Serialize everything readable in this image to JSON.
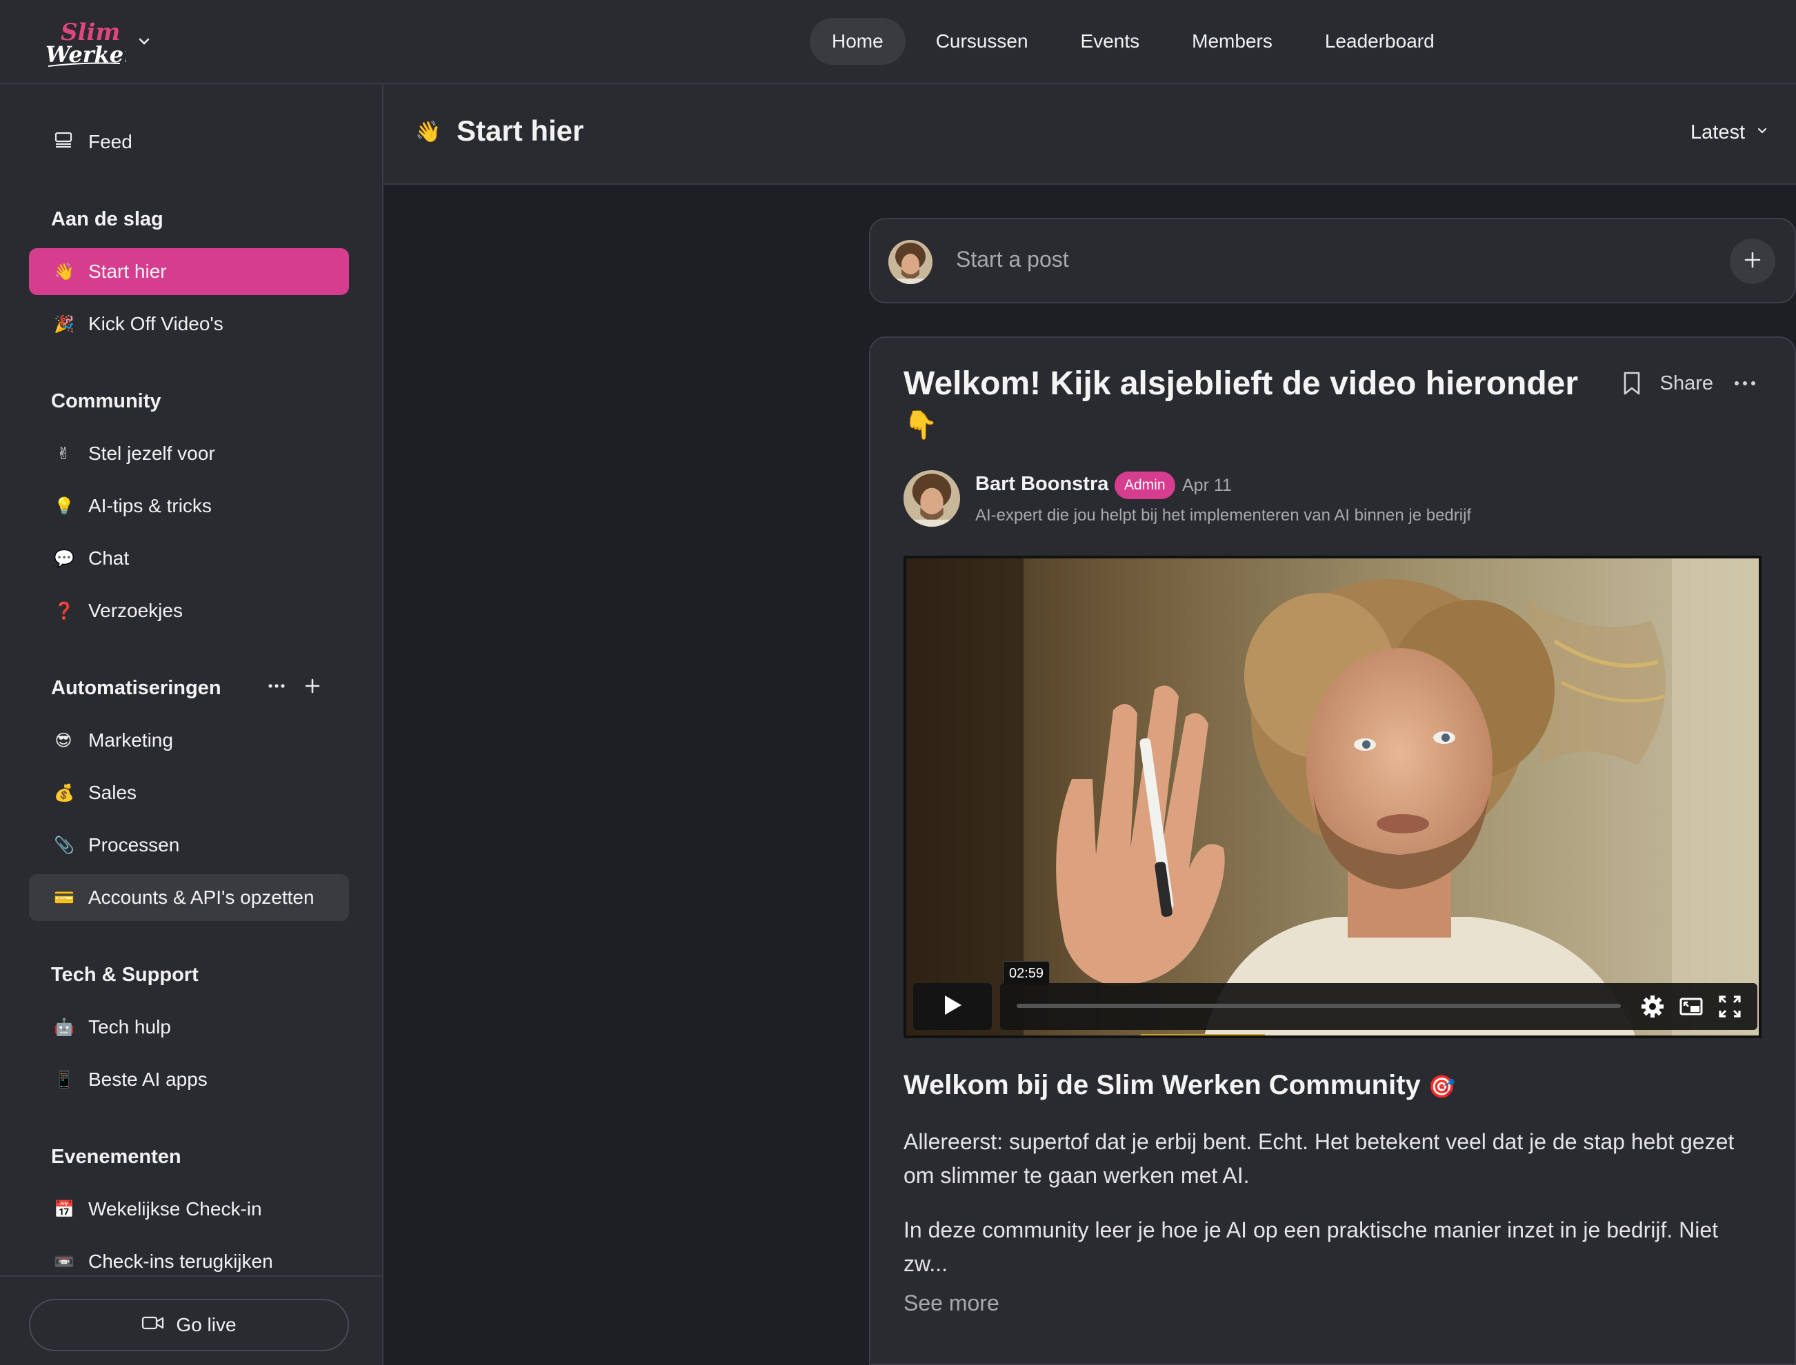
{
  "app": {
    "logo_text_top": "Slim",
    "logo_text_bottom": "Werken",
    "brand_color": "#d63d8f"
  },
  "topnav": {
    "items": [
      {
        "label": "Home",
        "active": true
      },
      {
        "label": "Cursussen"
      },
      {
        "label": "Events"
      },
      {
        "label": "Members"
      },
      {
        "label": "Leaderboard"
      }
    ]
  },
  "sidebar": {
    "feed": {
      "label": "Feed",
      "icon": "feed-icon"
    },
    "sections": [
      {
        "heading": "Aan de slag",
        "items": [
          {
            "emoji": "👋",
            "label": "Start hier",
            "active": true
          },
          {
            "emoji": "🎉",
            "label": "Kick Off Video's"
          }
        ]
      },
      {
        "heading": "Community",
        "items": [
          {
            "emoji": "✌",
            "label": "Stel jezelf voor"
          },
          {
            "emoji": "💡",
            "label": "AI-tips & tricks"
          },
          {
            "emoji": "💬",
            "label": "Chat"
          },
          {
            "emoji": "❓",
            "label": "Verzoekjes"
          }
        ]
      },
      {
        "heading": "Automatiseringen",
        "items": [
          {
            "emoji": "😎",
            "label": "Marketing"
          },
          {
            "emoji": "💰",
            "label": "Sales"
          },
          {
            "emoji": "📎",
            "label": "Processen"
          },
          {
            "emoji": "💳",
            "label": "Accounts & API's opzetten",
            "selected": true
          }
        ]
      },
      {
        "heading": "Tech & Support",
        "items": [
          {
            "emoji": "🤖",
            "label": "Tech hulp"
          },
          {
            "emoji": "📱",
            "label": "Beste AI apps"
          }
        ]
      },
      {
        "heading": "Evenementen",
        "items": [
          {
            "emoji": "📅",
            "label": "Wekelijkse Check-in"
          },
          {
            "emoji": "📼",
            "label": "Check-ins terugkijken"
          }
        ]
      }
    ],
    "go_live": "Go live"
  },
  "header": {
    "emoji": "👋",
    "title": "Start hier",
    "sort": "Latest"
  },
  "composer": {
    "placeholder": "Start a post"
  },
  "post": {
    "title": "Welkom! Kijk alsjeblieft de video hieronder",
    "title_emoji": "👇",
    "share": "Share",
    "author": "Bart Boonstra",
    "badge": "Admin",
    "date": "Apr 11",
    "bio": "AI-expert die jou helpt bij het implementeren van AI binnen je bedrijf",
    "video": {
      "duration": "02:59",
      "progress": 0
    },
    "subtitle": "Welkom bij de Slim Werken Community",
    "subtitle_emoji": "🎯",
    "paragraph1": "Allereerst: supertof dat je erbij bent. Echt. Het betekent veel dat je de stap hebt gezet om slimmer te gaan werken met AI.",
    "paragraph2": "In deze community leer je hoe je AI op een praktische manier inzet in je bedrijf. Niet zw...",
    "see_more": "See more"
  }
}
